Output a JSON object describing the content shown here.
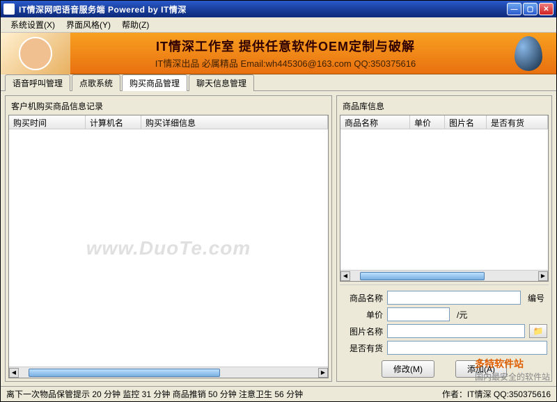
{
  "titlebar": {
    "text": "IT情深网吧语音服务端  Powered by IT情深"
  },
  "menu": {
    "system": "系统设置(X)",
    "style": "界面风格(Y)",
    "help": "帮助(Z)"
  },
  "banner": {
    "line1": "IT情深工作室 提供任意软件OEM定制与破解",
    "line2": "IT情深出品  必属精品  Email:wh445306@163.com  QQ:350375616"
  },
  "tabs": {
    "t1": "语音呼叫管理",
    "t2": "点歌系统",
    "t3": "购买商品管理",
    "t4": "聊天信息管理"
  },
  "left": {
    "title": "客户机购买商品信息记录",
    "cols": {
      "c1": "购买时间",
      "c2": "计算机名",
      "c3": "购买详细信息"
    }
  },
  "right": {
    "title": "商品库信息",
    "cols": {
      "c1": "商品名称",
      "c2": "单价",
      "c3": "图片名",
      "c4": "是否有货"
    }
  },
  "form": {
    "name_label": "商品名称",
    "id_label": "编号",
    "price_label": "单价",
    "price_unit": "/元",
    "image_label": "图片名称",
    "stock_label": "是否有货",
    "modify_btn": "修改(M)",
    "add_btn": "添加(A)"
  },
  "watermark": "www.DuoTe.com",
  "corner": "多特软件站",
  "corner2": "国内最安全的软件站",
  "status": {
    "left": "离下一次物品保管提示 20 分钟 监控 31 分钟 商品推销 50 分钟 注意卫生 56 分钟",
    "right": "作者：IT情深 QQ:350375616"
  }
}
